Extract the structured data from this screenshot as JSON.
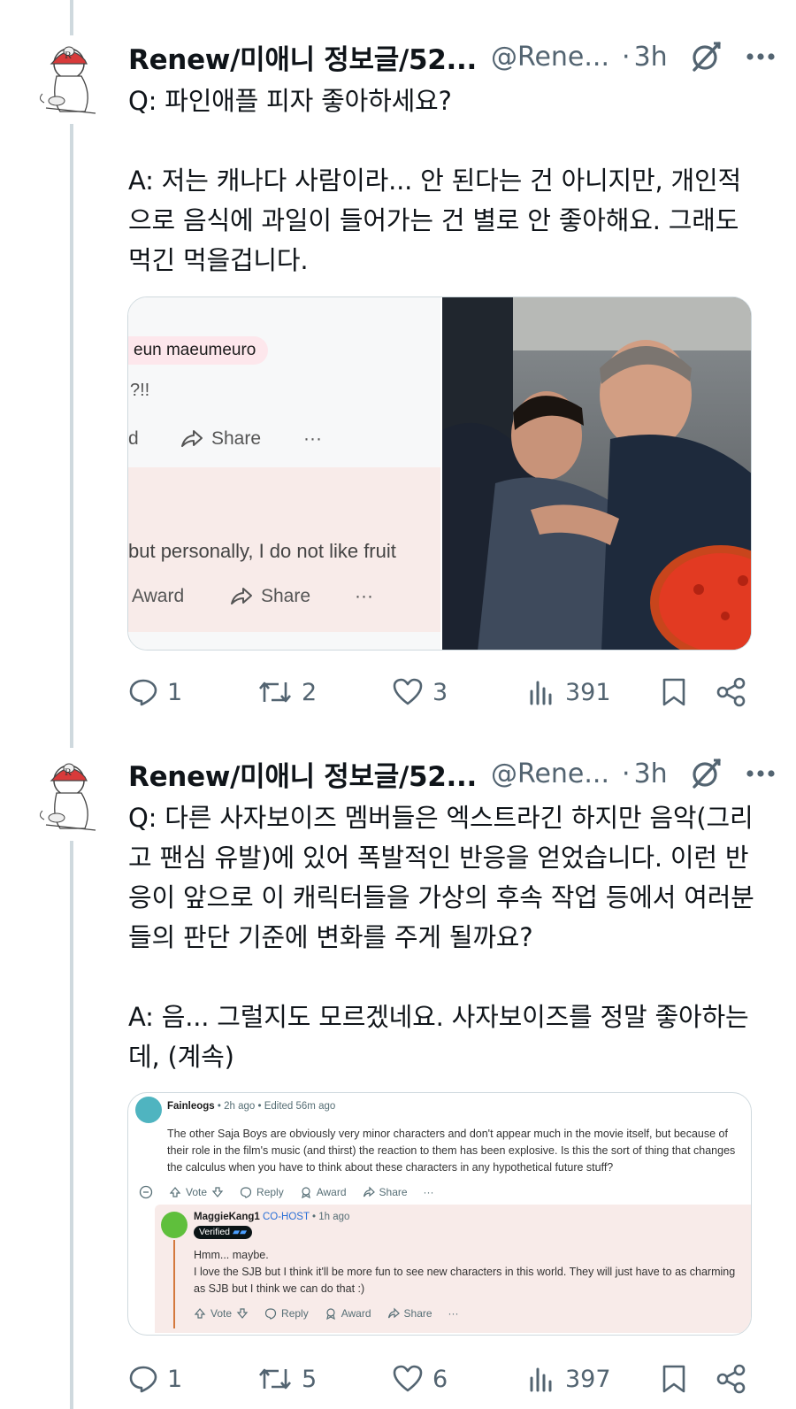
{
  "tweets": [
    {
      "author_name": "Renew/미애니 정보글/52...",
      "handle": "@Rene...",
      "time": "3h",
      "text": "Q: 파인애플 피자 좋아하세요?\n\nA: 저는 캐나다 사람이라... 안 된다는 건 아니지만, 개인적으로 음식에 과일이 들어가는 건 별로 안 좋아해요. 그래도 먹긴 먹을겁니다.",
      "media": {
        "pill_text": "eun maeumeuro",
        "question_fragment": "?!!",
        "row1_partial": "d",
        "share_label": "Share",
        "reply_fragment": "but personally, I do not like fruit",
        "award_label": "Award",
        "more_label": "···"
      },
      "stats": {
        "replies": "1",
        "reposts": "2",
        "likes": "3",
        "views": "391"
      }
    },
    {
      "author_name": "Renew/미애니 정보글/52...",
      "handle": "@Rene...",
      "time": "3h",
      "text": "Q: 다른 사자보이즈 멤버들은 엑스트라긴 하지만 음악(그리고 팬심 유발)에 있어 폭발적인 반응을 얻었습니다. 이런 반응이 앞으로 이 캐릭터들을 가상의 후속 작업 등에서 여러분들의 판단 기준에 변화를 주게 될까요?\n\nA: 음... 그럴지도 모르겠네요. 사자보이즈를 정말 좋아하는데, (계속)",
      "media": {
        "comment1": {
          "user": "Fainleogs",
          "meta": " • 2h ago • Edited 56m ago",
          "body": "The other Saja Boys are obviously very minor characters and don't appear much in the movie itself, but because of their role in the film's music (and thirst) the reaction to them has been explosive. Is this the sort of thing that changes the calculus when you have to think about these characters in any hypothetical future stuff?"
        },
        "comment2": {
          "user": "MaggieKang1",
          "cohost": "CO-HOST",
          "meta": " • 1h ago",
          "verified": "Verified",
          "body": "Hmm... maybe.\nI love the SJB but I think it'll be more fun to see new characters in this world. They will just have to as charming as SJB but I think we can do that :)"
        },
        "bar": {
          "vote": "Vote",
          "reply": "Reply",
          "award": "Award",
          "share": "Share",
          "more": "···"
        }
      },
      "stats": {
        "replies": "1",
        "reposts": "5",
        "likes": "6",
        "views": "397"
      }
    }
  ],
  "colors": {
    "text": "#0f1419",
    "secondary": "#536471",
    "thread_line": "#cfd9de"
  }
}
